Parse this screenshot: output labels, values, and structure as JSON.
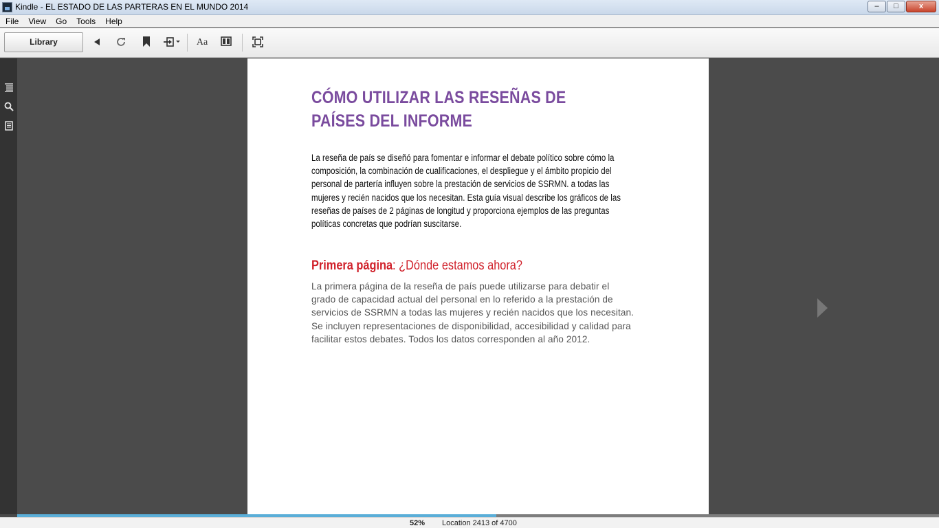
{
  "window": {
    "title": "Kindle - EL ESTADO DE LAS PARTERAS EN EL MUNDO 2014",
    "minimize_label": "–",
    "maximize_label": "□",
    "close_label": "x"
  },
  "menu": {
    "items": [
      {
        "label": "File"
      },
      {
        "label": "View"
      },
      {
        "label": "Go"
      },
      {
        "label": "Tools"
      },
      {
        "label": "Help"
      }
    ]
  },
  "toolbar": {
    "library_label": "Library",
    "icons": [
      "back-icon",
      "sync-icon",
      "bookmark-icon",
      "goto-icon",
      "font-settings-icon",
      "columns-icon",
      "fullscreen-icon"
    ],
    "font_button_label": "Aa"
  },
  "leftrail": {
    "icons": [
      "table-of-contents-icon",
      "search-icon",
      "notes-icon"
    ]
  },
  "page": {
    "heading": "CÓMO UTILIZAR LAS RESEÑAS DE PAÍSES DEL INFORME",
    "paragraph1": "La reseña de país se diseñó para fomentar e informar el debate político sobre cómo la composición, la combinación de cualificaciones, el despliegue y el ámbito propicio del personal de partería influyen sobre la prestación de servicios de SSRMN. a todas las mujeres y recién nacidos que los necesitan. Esta guía visual describe los gráficos de las reseñas de países de 2 páginas de longitud y proporciona ejemplos de las preguntas políticas concretas que podrían suscitarse.",
    "subheading_bold": "Primera página",
    "subheading_rest": ": ¿Dónde estamos ahora?",
    "paragraph2": "La primera página de la reseña de país puede utilizarse para debatir el grado de capacidad actual del personal en lo referido a la prestación de servicios de SSRMN a todas las mujeres y recién nacidos que los necesitan. Se incluyen representaciones de disponibilidad, accesibilidad y calidad para facilitar estos debates. Todos los datos corresponden al año 2012."
  },
  "status": {
    "percent": "52%",
    "progress_fraction": 0.52,
    "location": "Location 2413 of 4700"
  },
  "colors": {
    "heading": "#7a4b9e",
    "subheading": "#d0202a",
    "progress": "#5aaed8"
  }
}
